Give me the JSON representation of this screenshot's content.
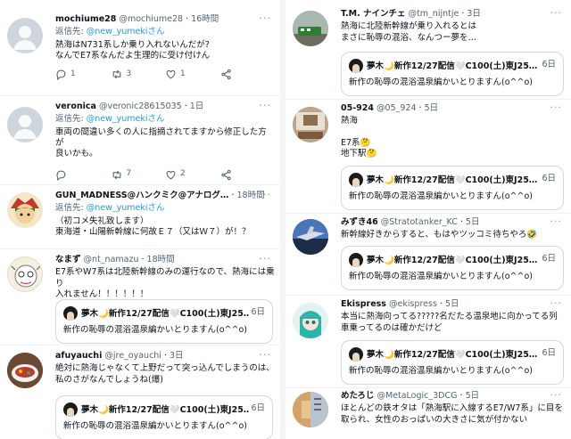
{
  "reply_prefix": "返信先:",
  "left": [
    {
      "name": "mochiume28",
      "handle": "@mochiume28",
      "time": "16時間",
      "reply_to": "@new_yumekiさん",
      "text": [
        "熱海はN731系しか乗り入れないんだが?",
        "なんでE7系なんだよ生理的に受け付けん"
      ],
      "counts": {
        "reply": "1",
        "retweet": "3",
        "like": "1"
      }
    },
    {
      "name": "veronica",
      "handle": "@veronic28615035",
      "time": "1日",
      "reply_to": "@new_yumekiさん",
      "text": [
        "車両の間違い多くの人に指摘されてますから修正した方が",
        "良いかも。"
      ],
      "counts": {
        "reply": "",
        "retweet": "7",
        "like": "2"
      }
    },
    {
      "name": "GUN_MADNESS@ハンクミク@アナログ…",
      "handle": "",
      "time": "18時間",
      "reply_to": "@new_yumekiさん",
      "text": [
        "（初コメ失礼致します）",
        "東海道・山陽新幹線に何故Ｅ７（又はＷ７）が！？"
      ]
    },
    {
      "name": "なまず",
      "handle": "@nt_namazu",
      "time": "18時間",
      "text": [
        "E7系やW7系は北陸新幹線のみの運行なので、熱海には乗り",
        "入れません！！！！！！"
      ]
    },
    {
      "name": "afuyauchi",
      "handle": "@jre_oyauchi",
      "time": "3日",
      "text": [
        "絶対に熱海じゃなくて上野だって突っ込んでしまうのは、",
        "私のさがなんでしょうね(爆)"
      ]
    }
  ],
  "right": [
    {
      "name": "T.M. ナインチェ",
      "handle": "@tm_nijntje",
      "time": "3日",
      "text": [
        "熱海に北陸新幹線が乗り入れるとは",
        "まさに恥辱の混浴、なんつー夢を…"
      ]
    },
    {
      "name": "05-924",
      "handle": "@05_924",
      "time": "5日",
      "text": [
        "熱海",
        "",
        "E7系🤔",
        "地下駅🤔"
      ]
    },
    {
      "name": "みずき46",
      "handle": "@Stratotanker_KC",
      "time": "5日",
      "text": [
        "新幹線好きからすると、もはやツッコミ待ちやろ🤣"
      ]
    },
    {
      "name": "Ekispress",
      "handle": "@ekispress",
      "time": "5日",
      "text": [
        "本当に熱海向ってる?????名だたる温泉地に向かってる列",
        "車乗ってるのは確かだけど"
      ]
    },
    {
      "name": "めたろじ",
      "handle": "@MetaLogic_3DCG",
      "time": "5日",
      "text": [
        "ほとんどの鉄オタは「熱海駅に入線するE7/W7系」に目を",
        "取られ、女性のおっぱいの大きさに気が付かない"
      ]
    }
  ],
  "quote": {
    "name": "夢木🌙新作12/27配信🤍C100(土)東J25…",
    "time": "6日",
    "text": "新作の恥辱の混浴温泉編かいとりますん(o^^o)"
  },
  "colors": {
    "text": "#0f1419",
    "secondary": "#536471",
    "link": "#1d9bf0",
    "border": "#cfd9de"
  }
}
